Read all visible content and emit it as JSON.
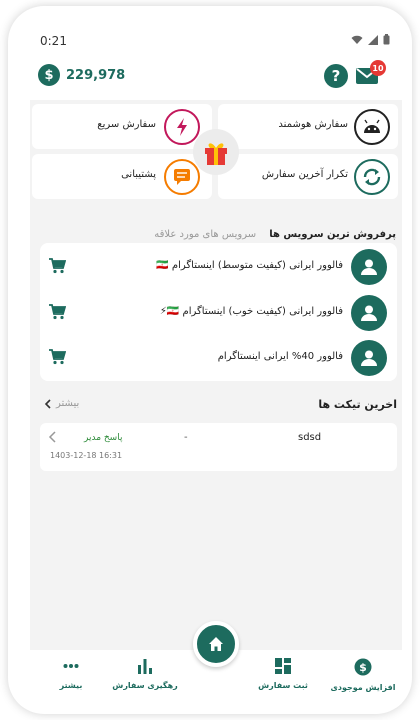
{
  "status_bar": {
    "time": "0:21"
  },
  "header": {
    "balance": "229,978",
    "mail_badge": "10"
  },
  "quick_actions": {
    "smart_order": "سفارش هوشمند",
    "fast_order": "سفارش سریع",
    "repeat_last_order": "تکرار آخرین سفارش",
    "support": "پشتیبانی"
  },
  "services_section": {
    "title": "پرفروش ترین سرویس ها",
    "subtitle": "سرویس های مورد علاقه",
    "items": [
      {
        "label": "فالوور ایرانی (کیفیت متوسط) اینستاگرام 🇮🇷"
      },
      {
        "label": "فالوور ایرانی (کیفیت خوب) اینستاگرام 🇮🇷⚡"
      },
      {
        "label": "فالوور 40% ایرانی اینستاگرام"
      }
    ]
  },
  "tickets_section": {
    "title": "اخرین تیکت ها",
    "more": "بیشتر",
    "items": [
      {
        "subject": "sdsd",
        "dash": "-",
        "status": "پاسخ مدیر",
        "date": "1403-12-18 16:31"
      }
    ]
  },
  "bottom_nav": {
    "add_balance": "افزایش موجودی",
    "new_order": "ثبت سفارش",
    "track_order": "رهگیری سفارش",
    "more": "بیشتر"
  },
  "colors": {
    "primary": "#1d6b5e",
    "accent_pink": "#c2185b",
    "accent_orange": "#f57c00",
    "badge_red": "#e53935",
    "status_green": "#2e8b3a"
  }
}
